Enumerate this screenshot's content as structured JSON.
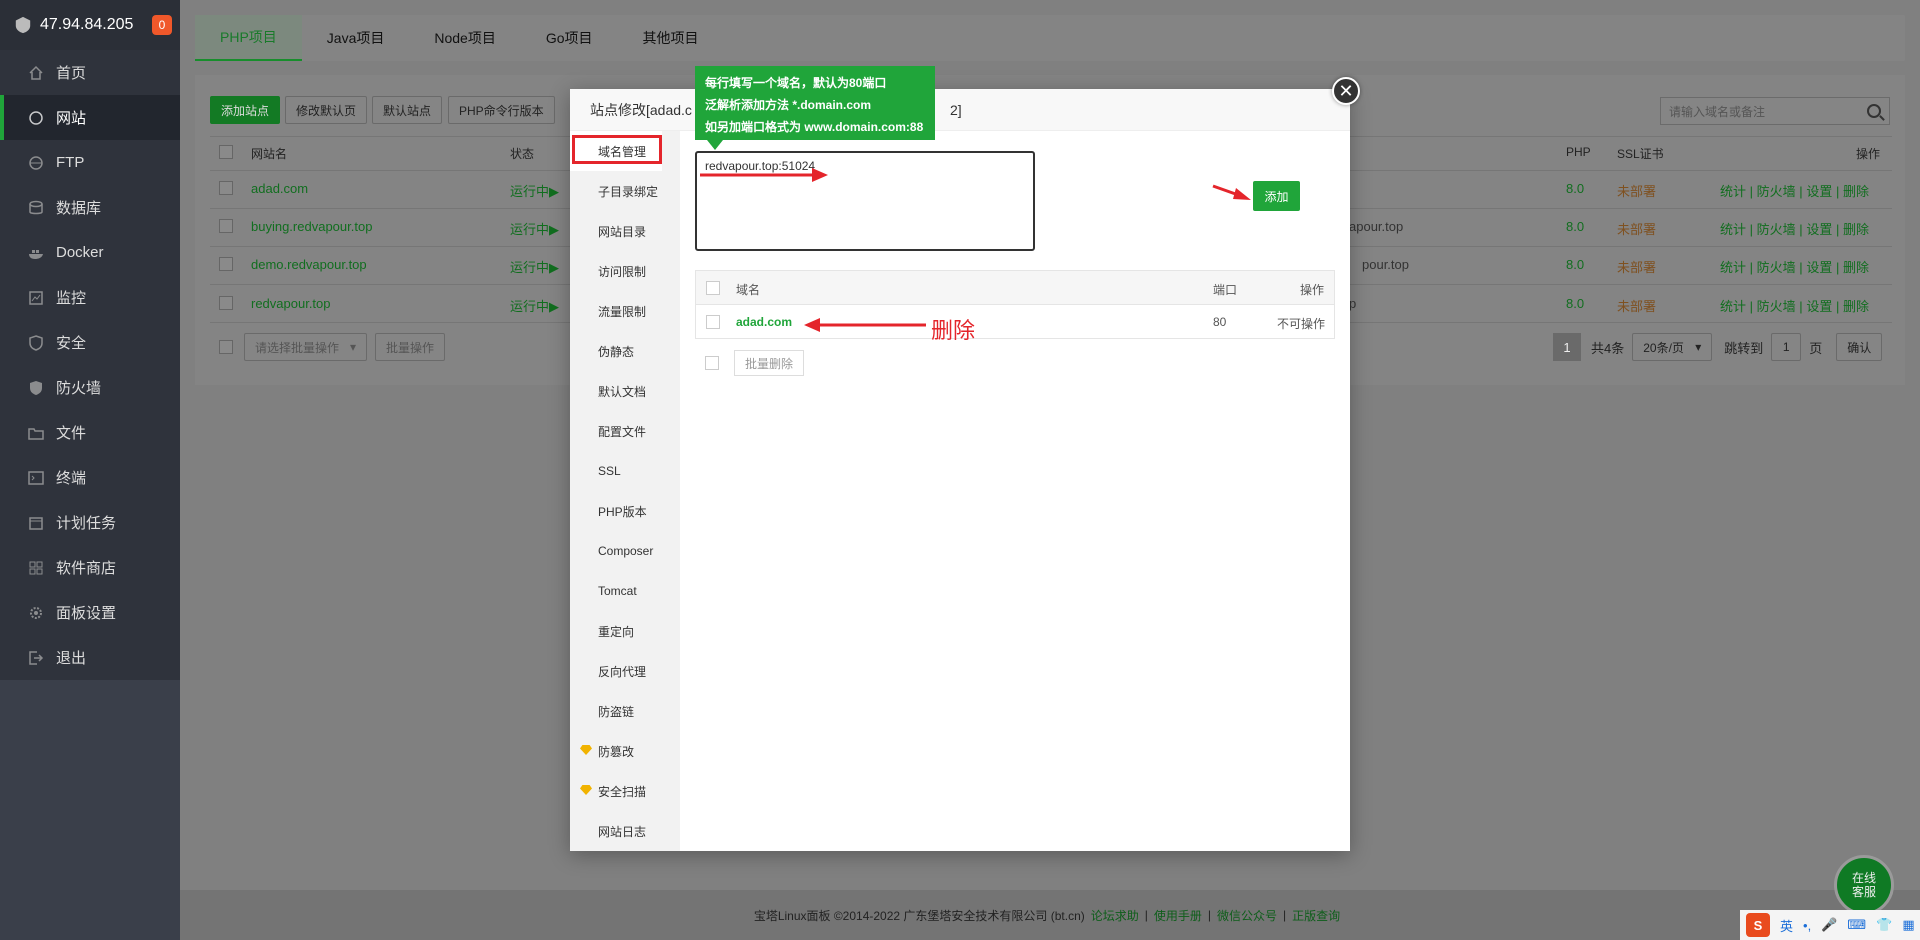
{
  "server": {
    "ip": "47.94.84.205",
    "badge": "0"
  },
  "sidebar": {
    "items": [
      {
        "label": "首页"
      },
      {
        "label": "网站"
      },
      {
        "label": "FTP"
      },
      {
        "label": "数据库"
      },
      {
        "label": "Docker"
      },
      {
        "label": "监控"
      },
      {
        "label": "安全"
      },
      {
        "label": "防火墙"
      },
      {
        "label": "文件"
      },
      {
        "label": "终端"
      },
      {
        "label": "计划任务"
      },
      {
        "label": "软件商店"
      },
      {
        "label": "面板设置"
      },
      {
        "label": "退出"
      }
    ]
  },
  "tabs": [
    "PHP项目",
    "Java项目",
    "Node项目",
    "Go项目",
    "其他项目"
  ],
  "toolbar": {
    "add_site": "添加站点",
    "edit_default": "修改默认页",
    "default_site": "默认站点",
    "php_cli": "PHP命令行版本",
    "search_placeholder": "请输入域名或备注"
  },
  "table": {
    "headers": {
      "name": "网站名",
      "status": "状态",
      "php": "PHP",
      "ssl": "SSL证书",
      "ops": "操作"
    },
    "rows": [
      {
        "name": "adad.com",
        "status": "运行中▶",
        "backup_tail": "",
        "php": "8.0",
        "ssl": "未部署"
      },
      {
        "name": "buying.redvapour.top",
        "status": "运行中▶",
        "backup_tail": "apour.top",
        "php": "8.0",
        "ssl": "未部署"
      },
      {
        "name": "demo.redvapour.top",
        "status": "运行中▶",
        "backup_tail": "pour.top",
        "php": "8.0",
        "ssl": "未部署"
      },
      {
        "name": "redvapour.top",
        "status": "运行中▶",
        "backup_tail": "p",
        "php": "8.0",
        "ssl": "未部署"
      }
    ],
    "row_ops": {
      "stats": "统计",
      "firewall": "防火墙",
      "settings": "设置",
      "delete": "删除",
      "sep": "|"
    },
    "batch_select": "请选择批量操作",
    "batch_btn": "批量操作"
  },
  "pager": {
    "page": "1",
    "total": "共4条",
    "per_page": "20条/页",
    "goto": "跳转到",
    "goto_value": "1",
    "page_unit": "页",
    "confirm": "确认"
  },
  "modal": {
    "title_left": "站点修改[adad.c",
    "title_right": "2]",
    "nav": [
      "域名管理",
      "子目录绑定",
      "网站目录",
      "访问限制",
      "流量限制",
      "伪静态",
      "默认文档",
      "配置文件",
      "SSL",
      "PHP版本",
      "Composer",
      "Tomcat",
      "重定向",
      "反向代理",
      "防盗链",
      "防篡改",
      "安全扫描",
      "网站日志"
    ],
    "tooltip": [
      "每行填写一个域名，默认为80端口",
      "泛解析添加方法 *.domain.com",
      "如另加端口格式为 www.domain.com:88"
    ],
    "textarea_value": "redvapour.top:51024",
    "add_btn": "添加",
    "domain_table": {
      "headers": {
        "domain": "域名",
        "port": "端口",
        "ops": "操作"
      },
      "rows": [
        {
          "domain": "adad.com",
          "port": "80",
          "op": "不可操作"
        }
      ]
    },
    "bulk_delete": "批量删除",
    "annotation": "删除"
  },
  "footer": {
    "copyright": "宝塔Linux面板 ©2014-2022 广东堡塔安全技术有限公司 (bt.cn)",
    "links": [
      "论坛求助",
      "使用手册",
      "微信公众号",
      "正版查询"
    ],
    "sep": "|"
  },
  "widgets": {
    "service_l1": "在线",
    "service_l2": "客服",
    "ime_lang": "英"
  },
  "colors": {
    "green": "#20a53a",
    "red": "#e4252b",
    "sidebar": "#2f333c"
  }
}
